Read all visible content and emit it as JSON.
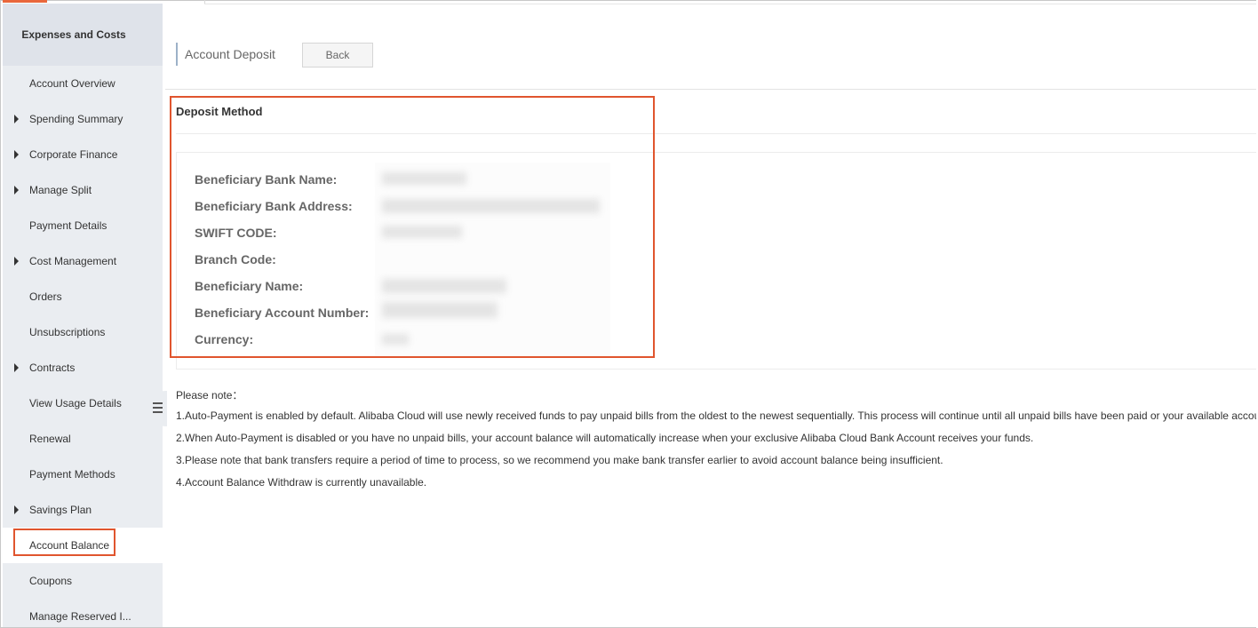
{
  "sidebar": {
    "title": "Expenses and Costs",
    "items": [
      {
        "label": "Account Overview",
        "expandable": false
      },
      {
        "label": "Spending Summary",
        "expandable": true
      },
      {
        "label": "Corporate Finance",
        "expandable": true
      },
      {
        "label": "Manage Split",
        "expandable": true
      },
      {
        "label": "Payment Details",
        "expandable": false
      },
      {
        "label": "Cost Management",
        "expandable": true
      },
      {
        "label": "Orders",
        "expandable": false
      },
      {
        "label": "Unsubscriptions",
        "expandable": false
      },
      {
        "label": "Contracts",
        "expandable": true
      },
      {
        "label": "View Usage Details",
        "expandable": false
      },
      {
        "label": "Renewal",
        "expandable": false
      },
      {
        "label": "Payment Methods",
        "expandable": false
      },
      {
        "label": "Savings Plan",
        "expandable": true
      },
      {
        "label": "Account Balance",
        "expandable": false,
        "active": true
      },
      {
        "label": "Coupons",
        "expandable": false
      },
      {
        "label": "Manage Reserved I...",
        "expandable": false
      }
    ]
  },
  "header": {
    "title": "Account Deposit",
    "back_label": "Back"
  },
  "deposit": {
    "section_title": "Deposit Method",
    "fields": [
      {
        "label": "Beneficiary Bank Name:"
      },
      {
        "label": "Beneficiary Bank Address:"
      },
      {
        "label": "SWIFT CODE:"
      },
      {
        "label": "Branch Code:"
      },
      {
        "label": "Beneficiary Name:"
      },
      {
        "label": "Beneficiary Account Number:"
      },
      {
        "label": "Currency:"
      }
    ]
  },
  "notes": {
    "title": "Please note：",
    "lines": [
      "1.Auto-Payment is enabled by default. Alibaba Cloud will use newly received funds to pay unpaid bills from the oldest to the newest sequentially. This process will continue until all unpaid bills have been paid or your available accou",
      "2.When Auto-Payment is disabled or you have no unpaid bills, your account balance will automatically increase when your exclusive Alibaba Cloud Bank Account receives your funds.",
      "3.Please note that bank transfers require a period of time to process, so we recommend you make bank transfer earlier to avoid account balance being insufficient.",
      "4.Account Balance Withdraw is currently unavailable."
    ]
  },
  "colors": {
    "accent": "#e9673c",
    "highlight": "#e0552e",
    "sidebar_bg": "#eaedf1",
    "sidebar_header_bg": "#dfe3ea"
  }
}
